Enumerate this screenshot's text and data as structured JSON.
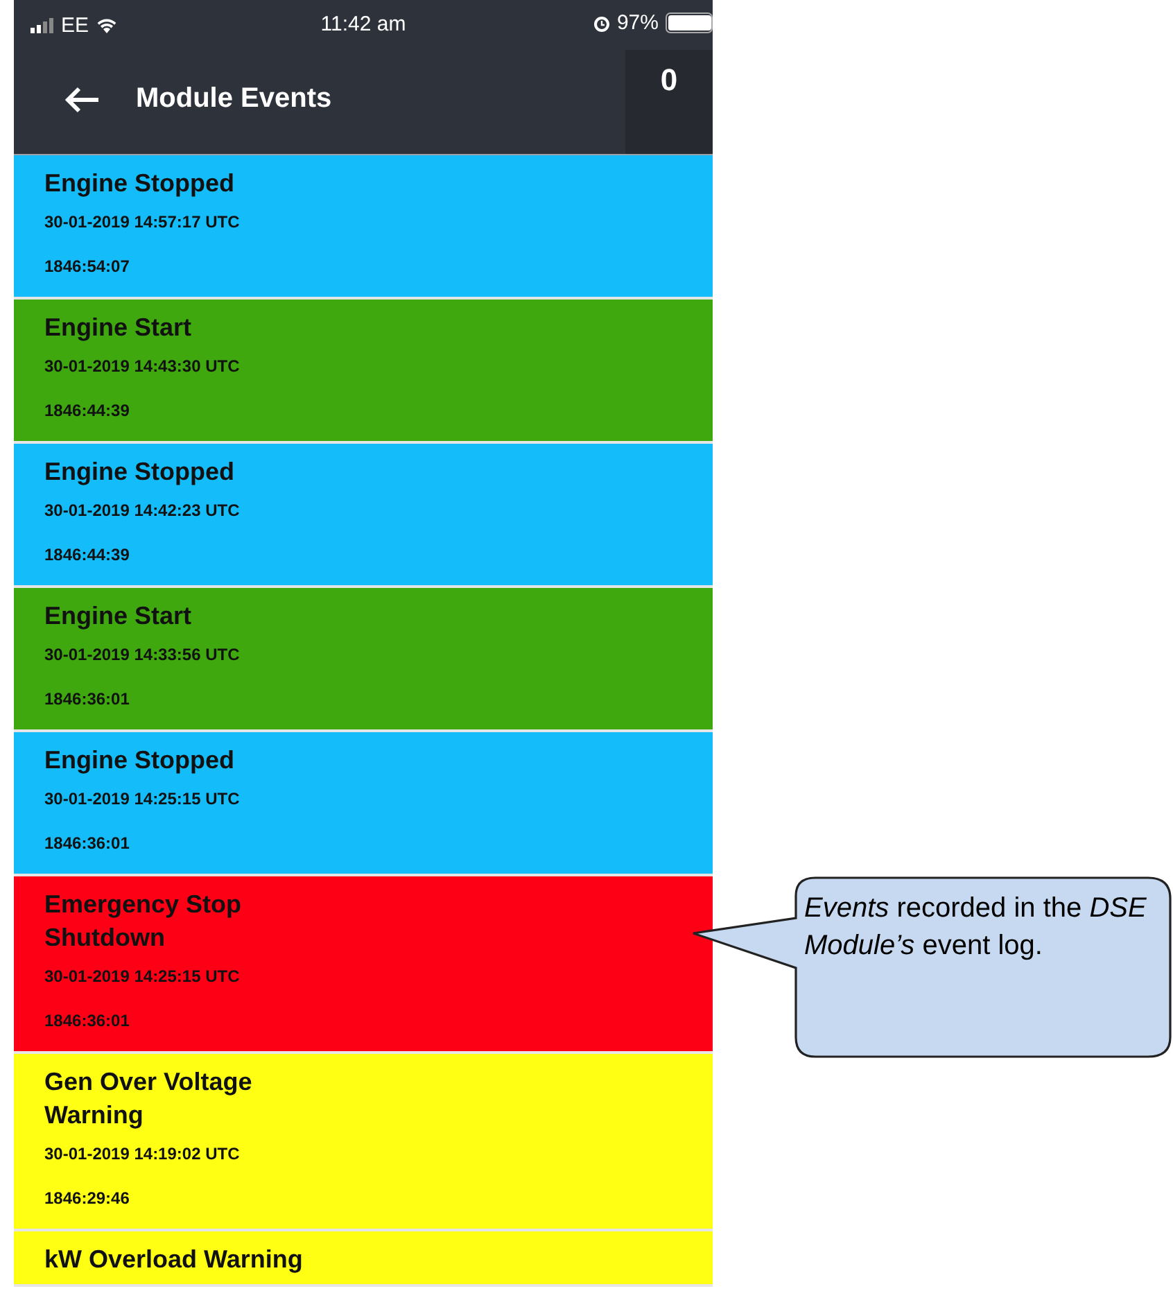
{
  "status_bar": {
    "carrier": "EE",
    "time": "11:42 am",
    "battery": "97%"
  },
  "header": {
    "title": "Module Events",
    "count": "0"
  },
  "events": [
    {
      "title": "Engine Stopped",
      "date": "30-01-2019 14:57:17 UTC",
      "hours": "1846:54:07",
      "color": "#14bdf9"
    },
    {
      "title": "Engine Start",
      "date": "30-01-2019 14:43:30 UTC",
      "hours": "1846:44:39",
      "color": "#3ea80e"
    },
    {
      "title": "Engine Stopped",
      "date": "30-01-2019 14:42:23 UTC",
      "hours": "1846:44:39",
      "color": "#14bdf9"
    },
    {
      "title": "Engine Start",
      "date": "30-01-2019 14:33:56 UTC",
      "hours": "1846:36:01",
      "color": "#3ea80e"
    },
    {
      "title": "Engine Stopped",
      "date": "30-01-2019 14:25:15 UTC",
      "hours": "1846:36:01",
      "color": "#14bdf9"
    },
    {
      "title": "Emergency Stop Shutdown",
      "date": "30-01-2019 14:25:15 UTC",
      "hours": "1846:36:01",
      "color": "#fe0016"
    },
    {
      "title": "Gen Over Voltage Warning",
      "date": "30-01-2019 14:19:02 UTC",
      "hours": "1846:29:46",
      "color": "#ffff14"
    },
    {
      "title": "kW Overload Warning",
      "color": "#ffff14"
    }
  ],
  "callout": {
    "text": "*Events* recorded in the *DSE Module’s* event log."
  }
}
